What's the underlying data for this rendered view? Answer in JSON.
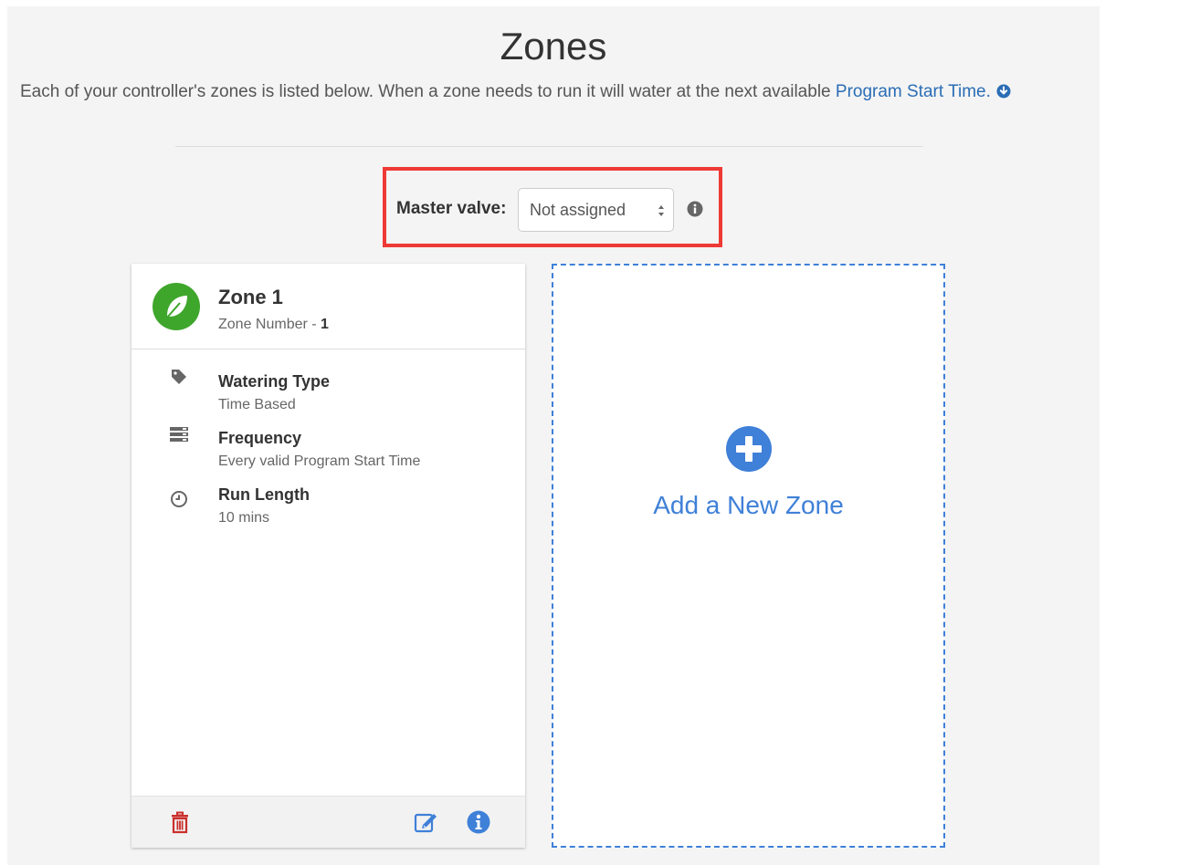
{
  "page": {
    "title": "Zones",
    "intro": "Each of your controller's zones is listed below. When a zone needs to run it will water at the next available ",
    "intro_link": "Program Start Time."
  },
  "master_valve": {
    "label": "Master valve:",
    "selected": "Not assigned"
  },
  "zone_card": {
    "name": "Zone 1",
    "number_prefix": "Zone Number - ",
    "number": "1",
    "attributes": [
      {
        "title": "Watering Type",
        "value": "Time Based",
        "icon": "tag-icon"
      },
      {
        "title": "Frequency",
        "value": "Every valid Program Start Time",
        "icon": "list-icon"
      },
      {
        "title": "Run Length",
        "value": "10 mins",
        "icon": "clock-icon"
      }
    ]
  },
  "add_zone": {
    "label": "Add a New Zone"
  },
  "colors": {
    "accent_blue": "#3f80d8",
    "link_blue": "#2a6db5",
    "leaf_green": "#3fa62c",
    "delete_red": "#c9302c",
    "highlight_red": "#ee3a35"
  }
}
